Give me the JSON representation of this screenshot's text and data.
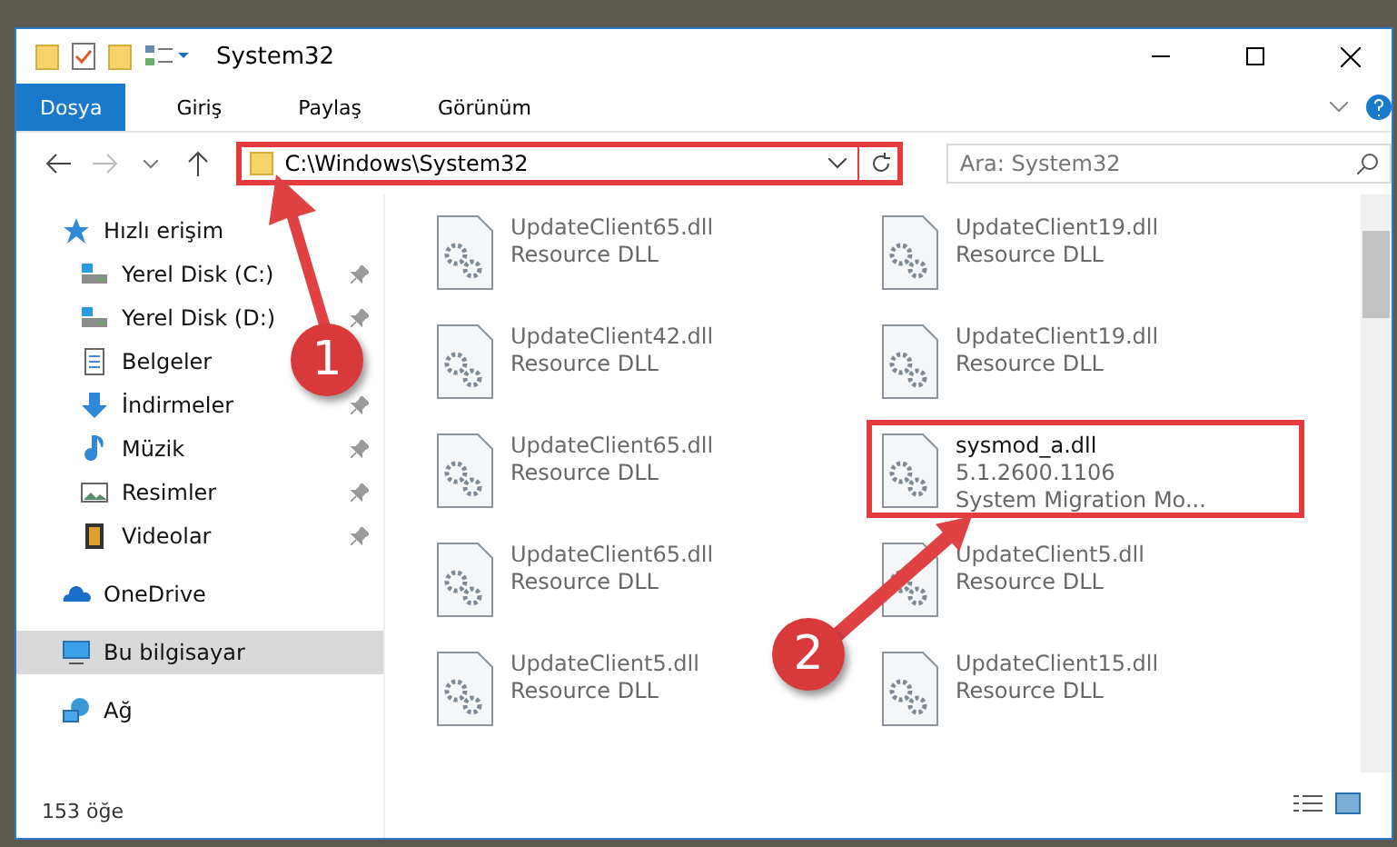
{
  "window": {
    "title": "System32"
  },
  "ribbon": {
    "tabs": [
      {
        "label": "Dosya",
        "selected": true
      },
      {
        "label": "Giriş",
        "selected": false
      },
      {
        "label": "Paylaş",
        "selected": false
      },
      {
        "label": "Görünüm",
        "selected": false
      }
    ]
  },
  "address": {
    "path": "C:\\Windows\\System32",
    "highlighted": true
  },
  "search": {
    "placeholder": "Ara: System32"
  },
  "sidebar": {
    "items": [
      {
        "label": "Hızlı erişim",
        "selected": false,
        "children": [
          {
            "label": "Yerel Disk (C:)",
            "pinned": true,
            "selected": false
          },
          {
            "label": "Yerel Disk (D:)",
            "pinned": true,
            "selected": false
          },
          {
            "label": "Belgeler",
            "pinned": false,
            "selected": false
          },
          {
            "label": "İndirmeler",
            "pinned": true,
            "selected": false
          },
          {
            "label": "Müzik",
            "pinned": true,
            "selected": false
          },
          {
            "label": "Resimler",
            "pinned": true,
            "selected": false
          },
          {
            "label": "Videolar",
            "pinned": true,
            "selected": false
          }
        ]
      },
      {
        "label": "OneDrive",
        "selected": false
      },
      {
        "label": "Bu bilgisayar",
        "selected": true
      },
      {
        "label": "Ağ",
        "selected": false
      }
    ]
  },
  "files": [
    {
      "name": "UpdateClient65.dll",
      "lines": [
        "Resource DLL"
      ],
      "blurred": true,
      "highlighted": false
    },
    {
      "name": "UpdateClient19.dll",
      "lines": [
        "Resource DLL"
      ],
      "blurred": true,
      "highlighted": false
    },
    {
      "name": "UpdateClient42.dll",
      "lines": [
        "Resource DLL"
      ],
      "blurred": true,
      "highlighted": false
    },
    {
      "name": "UpdateClient19.dll",
      "lines": [
        "Resource DLL"
      ],
      "blurred": true,
      "highlighted": false
    },
    {
      "name": "UpdateClient65.dll",
      "lines": [
        "Resource DLL"
      ],
      "blurred": true,
      "highlighted": false
    },
    {
      "name": "sysmod_a.dll",
      "lines": [
        "5.1.2600.1106",
        "System Migration Mo..."
      ],
      "blurred": false,
      "highlighted": true
    },
    {
      "name": "UpdateClient65.dll",
      "lines": [
        "Resource DLL"
      ],
      "blurred": true,
      "highlighted": false
    },
    {
      "name": "UpdateClient5.dll",
      "lines": [
        "Resource DLL"
      ],
      "blurred": true,
      "highlighted": false
    },
    {
      "name": "UpdateClient5.dll",
      "lines": [
        "Resource DLL"
      ],
      "blurred": true,
      "highlighted": false
    },
    {
      "name": "UpdateClient15.dll",
      "lines": [
        "Resource DLL"
      ],
      "blurred": true,
      "highlighted": false
    }
  ],
  "status_bar": {
    "count": "153 öğe"
  },
  "annotations": [
    {
      "label": "1"
    },
    {
      "label": "2"
    }
  ]
}
